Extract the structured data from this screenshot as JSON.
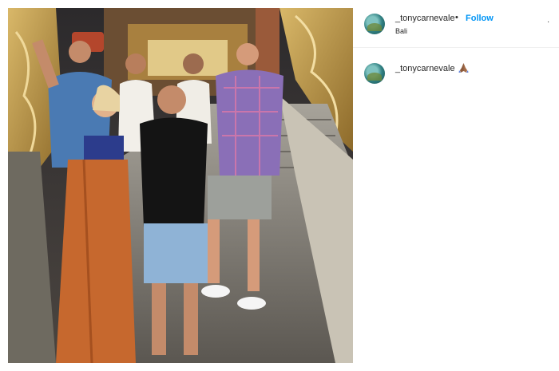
{
  "post": {
    "photo_alt": "",
    "header": {
      "username": "_tonycarnevale",
      "separator": "•",
      "follow_label": "Follow",
      "location": "Bali",
      "more_label": "·"
    },
    "caption": {
      "username": "_tonycarnevale",
      "emoji_icon": "folded-hands-icon"
    },
    "colors": {
      "follow": "#0095f6",
      "text": "#262626"
    }
  }
}
